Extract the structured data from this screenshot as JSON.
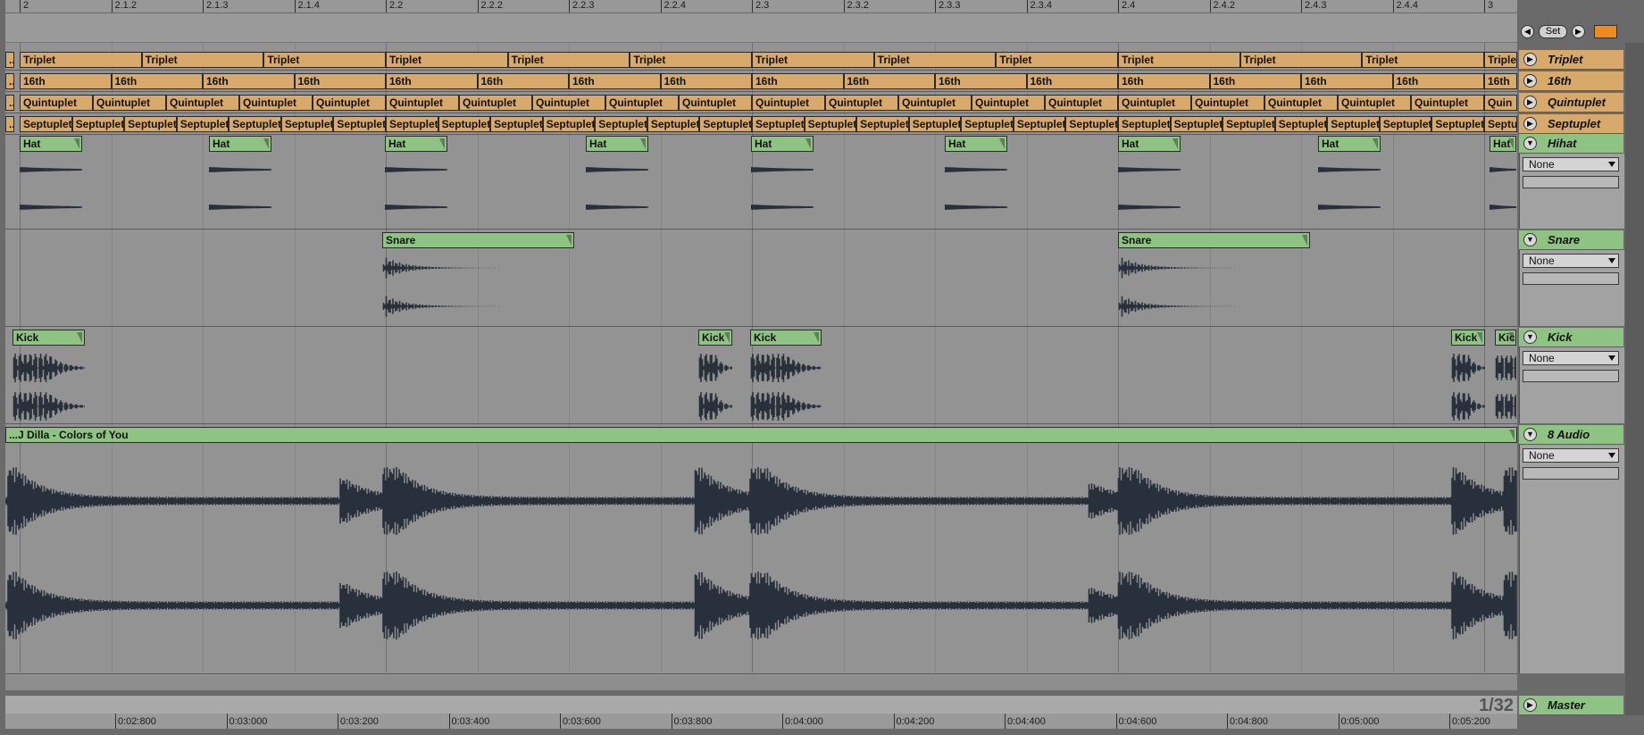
{
  "ruler_top": [
    "2",
    "2.1.2",
    "2.1.3",
    "2.1.4",
    "2.2",
    "2.2.2",
    "2.2.3",
    "2.2.4",
    "2.3",
    "2.3.2",
    "2.3.3",
    "2.3.4",
    "2.4",
    "2.4.2",
    "2.4.3",
    "2.4.4",
    "3"
  ],
  "ruler_bottom": [
    "0:02:800",
    "0:03:000",
    "0:03:200",
    "0:03:400",
    "0:03:600",
    "0:03:800",
    "0:04:000",
    "0:04:200",
    "0:04:400",
    "0:04:600",
    "0:04:800",
    "0:05:000",
    "0:05:200"
  ],
  "set_controls": {
    "prev_icon": "arrow-left-icon",
    "set_label": "Set",
    "next_icon": "arrow-right-icon",
    "lock_icon": "lock-icon"
  },
  "colors": {
    "orange": "#d7a96b",
    "green": "#8fc383",
    "wave": "#28303c",
    "lane": "#939393"
  },
  "tracks": [
    {
      "name": "Triplet",
      "kind": "grid",
      "clip_label": "Triplet"
    },
    {
      "name": "16th",
      "kind": "grid",
      "clip_label": "16th"
    },
    {
      "name": "Quintuplet",
      "kind": "grid",
      "clip_label": "Quintuplet"
    },
    {
      "name": "Septuplet",
      "kind": "grid",
      "clip_label": "Septuplet"
    },
    {
      "name": "Hihat",
      "kind": "audio",
      "clip_label": "Hat",
      "select": "None"
    },
    {
      "name": "Snare",
      "kind": "audio",
      "clip_label": "Snare",
      "select": "None"
    },
    {
      "name": "Kick",
      "kind": "audio",
      "clip_label": "Kick",
      "select": "None"
    },
    {
      "name": "8 Audio",
      "kind": "audio",
      "clip_label": "...J Dilla - Colors of You",
      "select": "None"
    }
  ],
  "truncated_labels": {
    "start": "...",
    "triplet_end": "Triple",
    "quint_end": "Quin",
    "sept_end": "Septu",
    "kick_end": "Kick"
  },
  "quantization": "1/32",
  "master": {
    "name": "Master"
  }
}
